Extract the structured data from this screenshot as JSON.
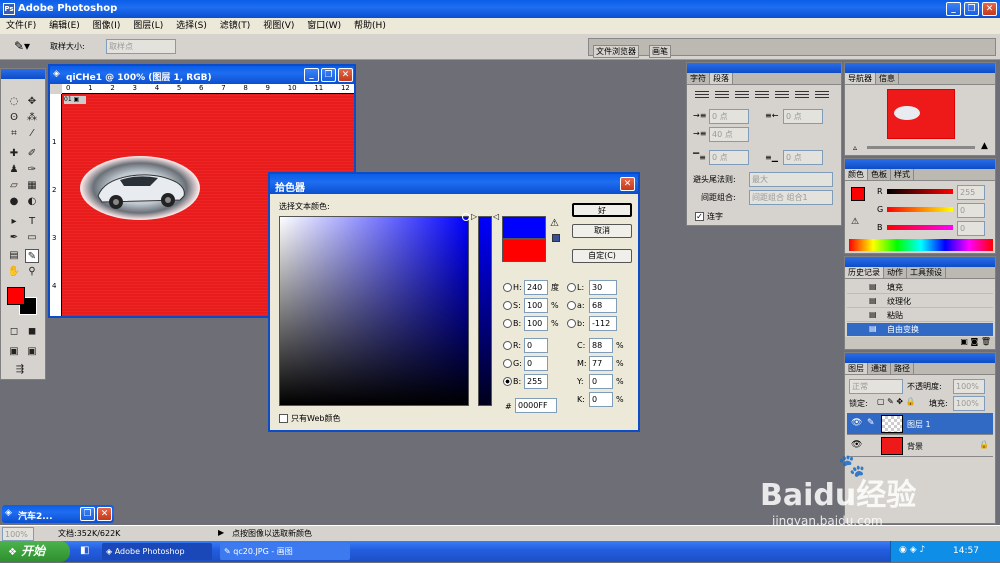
{
  "app": {
    "title": "Adobe Photoshop"
  },
  "menu": [
    "文件(F)",
    "编辑(E)",
    "图像(I)",
    "图层(L)",
    "选择(S)",
    "滤镜(T)",
    "视图(V)",
    "窗口(W)",
    "帮助(H)"
  ],
  "options": {
    "sample_size_label": "取样大小:",
    "sample_size_value": "取样点",
    "tab_file_browser": "文件浏览器",
    "tab_brushes": "画笔"
  },
  "document": {
    "title": "qiCHe1 @ 100% (图层 1, RGB)",
    "ruler": [
      "0",
      "1",
      "2",
      "3",
      "4",
      "5",
      "6",
      "7",
      "8",
      "9",
      "10",
      "11",
      "12"
    ],
    "left_ruler": [
      "1",
      "2",
      "3",
      "4"
    ]
  },
  "colors": {
    "canvas": "#ee1a1a",
    "foreground": "#ff0000",
    "background": "#000000",
    "new_color": "#0000ff",
    "current_color": "#ff0000"
  },
  "picker": {
    "title": "拾色器",
    "label": "选择文本颜色:",
    "ok": "好",
    "cancel": "取消",
    "custom": "自定(C)",
    "H": "240",
    "H_unit": "度",
    "S": "100",
    "S_unit": "%",
    "B": "100",
    "B_unit": "%",
    "R": "0",
    "G": "0",
    "Bv": "255",
    "L": "30",
    "a": "68",
    "b": "-112",
    "C": "88",
    "M": "77",
    "Y": "0",
    "K": "0",
    "pct": "%",
    "hex": "0000FF",
    "hex_label": "#",
    "web_only": "只有Web颜色",
    "lbl_H": "H:",
    "lbl_S": "S:",
    "lbl_B": "B:",
    "lbl_R": "R:",
    "lbl_G": "G:",
    "lbl_B2": "B:",
    "lbl_L": "L:",
    "lbl_a": "a:",
    "lbl_b": "b:",
    "lbl_C": "C:",
    "lbl_M": "M:",
    "lbl_Y": "Y:",
    "lbl_K": "K:"
  },
  "char_panel": {
    "tab_char": "字符",
    "tab_para": "段落",
    "pt0": "0 点",
    "pt40": "40 点",
    "avoid_label": "避头尾法则:",
    "avoid_value": "最大",
    "spacing_label": "间距组合:",
    "spacing_value": "间距组合 组合1",
    "hyphen": "连字"
  },
  "nav_panel": {
    "tab_nav": "导航器",
    "tab_info": "信息"
  },
  "color_panel": {
    "tab_color": "颜色",
    "tab_swatch": "色板",
    "tab_style": "样式",
    "R": "R",
    "G": "G",
    "B": "B",
    "Rv": "255",
    "Gv": "0",
    "Bv": "0"
  },
  "history": {
    "tab_history": "历史记录",
    "tab_actions": "动作",
    "tab_presets": "工具预设",
    "items": [
      "填充",
      "纹理化",
      "粘贴",
      "自由变换"
    ]
  },
  "layers": {
    "tab_layers": "图层",
    "tab_channels": "通道",
    "tab_paths": "路径",
    "blend": "正常",
    "opacity_label": "不透明度:",
    "opacity": "100%",
    "lock_label": "锁定:",
    "fill_label": "填充:",
    "fill": "100%",
    "items": [
      "图层 1",
      "背景"
    ]
  },
  "minimized": {
    "title": "汽车2..."
  },
  "status": {
    "zoom": "100%",
    "doc": "文档:352K/622K",
    "hint": "点按图像以选取新颜色"
  },
  "taskbar": {
    "start": "开始",
    "items": [
      "Adobe Photoshop",
      "qc20.JPG - 画图"
    ],
    "time": "14:57"
  },
  "watermark": {
    "brand": "Baidu经验",
    "url": "jingyan.baidu.com"
  }
}
